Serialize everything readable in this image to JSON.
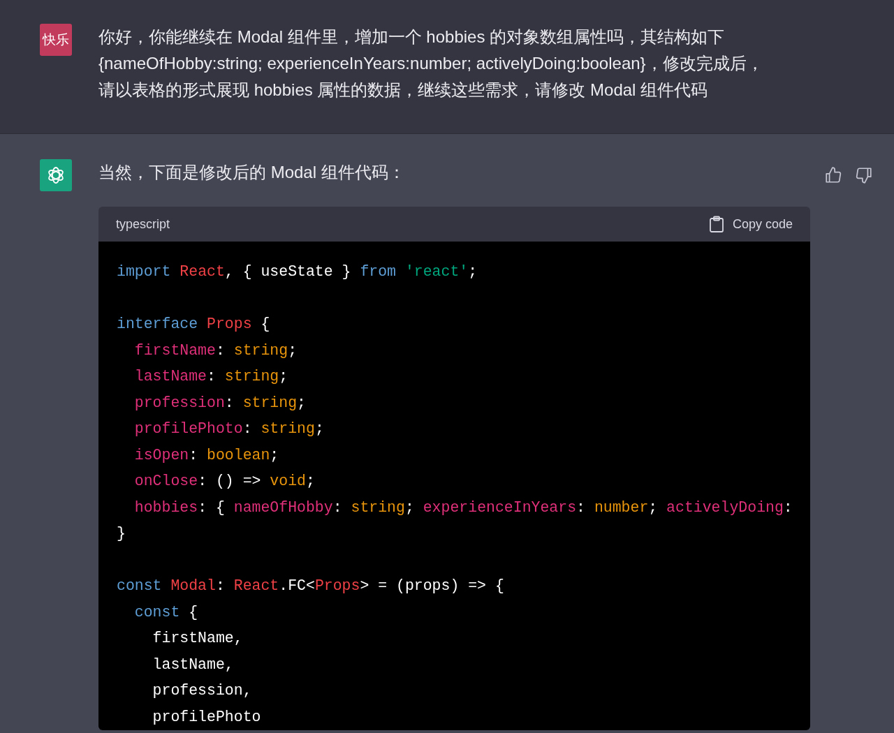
{
  "messages": [
    {
      "kind": "user",
      "avatar": "快乐",
      "lines": [
        "你好，你能继续在 Modal 组件里，增加一个 hobbies 的对象数组属性吗，其结构如下",
        "{nameOfHobby:string; experienceInYears:number; activelyDoing:boolean}，修改完成后，",
        "请以表格的形式展现 hobbies 属性的数据，继续这些需求，请修改 Modal 组件代码"
      ]
    },
    {
      "kind": "assistant",
      "lines": [
        "当然，下面是修改后的 Modal 组件代码："
      ],
      "code": {
        "language": "typescript",
        "copy_label": "Copy code",
        "lines": [
          {
            "tokens": [
              {
                "t": "import",
                "kind": "keyword"
              },
              {
                "t": " React",
                "kind": "class"
              },
              {
                "t": ", { useState } "
              },
              {
                "t": "from",
                "kind": "keyword"
              },
              {
                "t": " 'react'",
                "kind": "string"
              },
              {
                "t": ";"
              }
            ]
          },
          {
            "kind": "blank"
          },
          {
            "tokens": [
              {
                "t": "interface",
                "kind": "keyword"
              },
              {
                "t": " Props",
                "kind": "class"
              },
              {
                "t": " {"
              }
            ]
          },
          {
            "tokens": [
              {
                "t": "  firstName",
                "kind": "property"
              },
              {
                "t": ": "
              },
              {
                "t": "string",
                "kind": "type"
              },
              {
                "t": ";"
              }
            ]
          },
          {
            "tokens": [
              {
                "t": "  lastName",
                "kind": "property"
              },
              {
                "t": ": "
              },
              {
                "t": "string",
                "kind": "type"
              },
              {
                "t": ";"
              }
            ]
          },
          {
            "tokens": [
              {
                "t": "  profession",
                "kind": "property"
              },
              {
                "t": ": "
              },
              {
                "t": "string",
                "kind": "type"
              },
              {
                "t": ";"
              }
            ]
          },
          {
            "tokens": [
              {
                "t": "  profilePhoto",
                "kind": "property"
              },
              {
                "t": ": "
              },
              {
                "t": "string",
                "kind": "type"
              },
              {
                "t": ";"
              }
            ]
          },
          {
            "tokens": [
              {
                "t": "  isOpen",
                "kind": "property"
              },
              {
                "t": ": "
              },
              {
                "t": "boolean",
                "kind": "type"
              },
              {
                "t": ";"
              }
            ]
          },
          {
            "tokens": [
              {
                "t": "  onClose",
                "kind": "property"
              },
              {
                "t": ": () => "
              },
              {
                "t": "void",
                "kind": "type"
              },
              {
                "t": ";"
              }
            ]
          },
          {
            "tokens": [
              {
                "t": "  hobbies",
                "kind": "property"
              },
              {
                "t": ": { "
              },
              {
                "t": "nameOfHobby",
                "kind": "property"
              },
              {
                "t": ": "
              },
              {
                "t": "string",
                "kind": "type"
              },
              {
                "t": "; "
              },
              {
                "t": "experienceInYears",
                "kind": "property"
              },
              {
                "t": ": "
              },
              {
                "t": "number",
                "kind": "type"
              },
              {
                "t": "; "
              },
              {
                "t": "activelyDoing",
                "kind": "property"
              },
              {
                "t": ":"
              }
            ]
          },
          {
            "tokens": [
              {
                "t": "}"
              }
            ]
          },
          {
            "kind": "blank"
          },
          {
            "tokens": [
              {
                "t": "const",
                "kind": "keyword"
              },
              {
                "t": " Modal",
                "kind": "class"
              },
              {
                "t": ": "
              },
              {
                "t": "React",
                "kind": "class"
              },
              {
                "t": ".FC<"
              },
              {
                "t": "Props",
                "kind": "class"
              },
              {
                "t": "> = (props) => {"
              }
            ]
          },
          {
            "tokens": [
              {
                "t": "  const",
                "kind": "keyword"
              },
              {
                "t": " {"
              }
            ]
          },
          {
            "tokens": [
              {
                "t": "    firstName,"
              }
            ]
          },
          {
            "tokens": [
              {
                "t": "    lastName,"
              }
            ]
          },
          {
            "tokens": [
              {
                "t": "    profession,"
              }
            ]
          },
          {
            "tokens": [
              {
                "t": "    profilePhoto"
              }
            ]
          }
        ]
      }
    }
  ]
}
